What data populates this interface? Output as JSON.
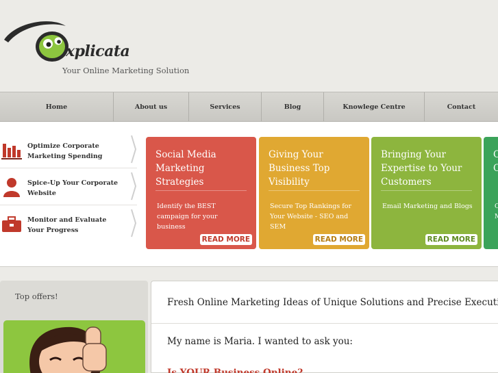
{
  "brand": {
    "logo_text": "xplicata",
    "tagline": "Your Online Marketing Solution"
  },
  "nav": {
    "items": [
      {
        "label": "Home"
      },
      {
        "label": "About us"
      },
      {
        "label": "Services"
      },
      {
        "label": "Blog"
      },
      {
        "label": "Knowlege Centre"
      },
      {
        "label": "Contact"
      }
    ]
  },
  "side_list": {
    "items": [
      {
        "label": "Optimize Corporate Marketing Spending",
        "icon": "bar-chart-icon"
      },
      {
        "label": "Spice-Up Your Corporate Website",
        "icon": "person-icon"
      },
      {
        "label": "Monitor and Evaluate Your Progress",
        "icon": "briefcase-icon"
      }
    ]
  },
  "cards": [
    {
      "title": "Social Media Marketing Strategies",
      "desc": "Identify the BEST campaign for your business",
      "button": "READ MORE",
      "color": "#d9574a"
    },
    {
      "title": "Giving Your Business Top Visibility",
      "desc": "Secure Top Rankings for Your Website - SEO and SEM",
      "button": "READ MORE",
      "color": "#e0a832"
    },
    {
      "title": "Bringing Your Expertise to Your Customers",
      "desc": "Email Marketing and Blogs",
      "button": "READ MORE",
      "color": "#8db53e"
    },
    {
      "title": "C C",
      "desc": "C M",
      "button": "",
      "color": "#3ba35a"
    }
  ],
  "offers": {
    "title": "Top offers!"
  },
  "content": {
    "title": "Fresh Online Marketing Ideas of Unique Solutions and Precise Execution",
    "intro": "My name is Maria. I wanted to ask you:",
    "question": "Is YOUR Business Online?"
  }
}
